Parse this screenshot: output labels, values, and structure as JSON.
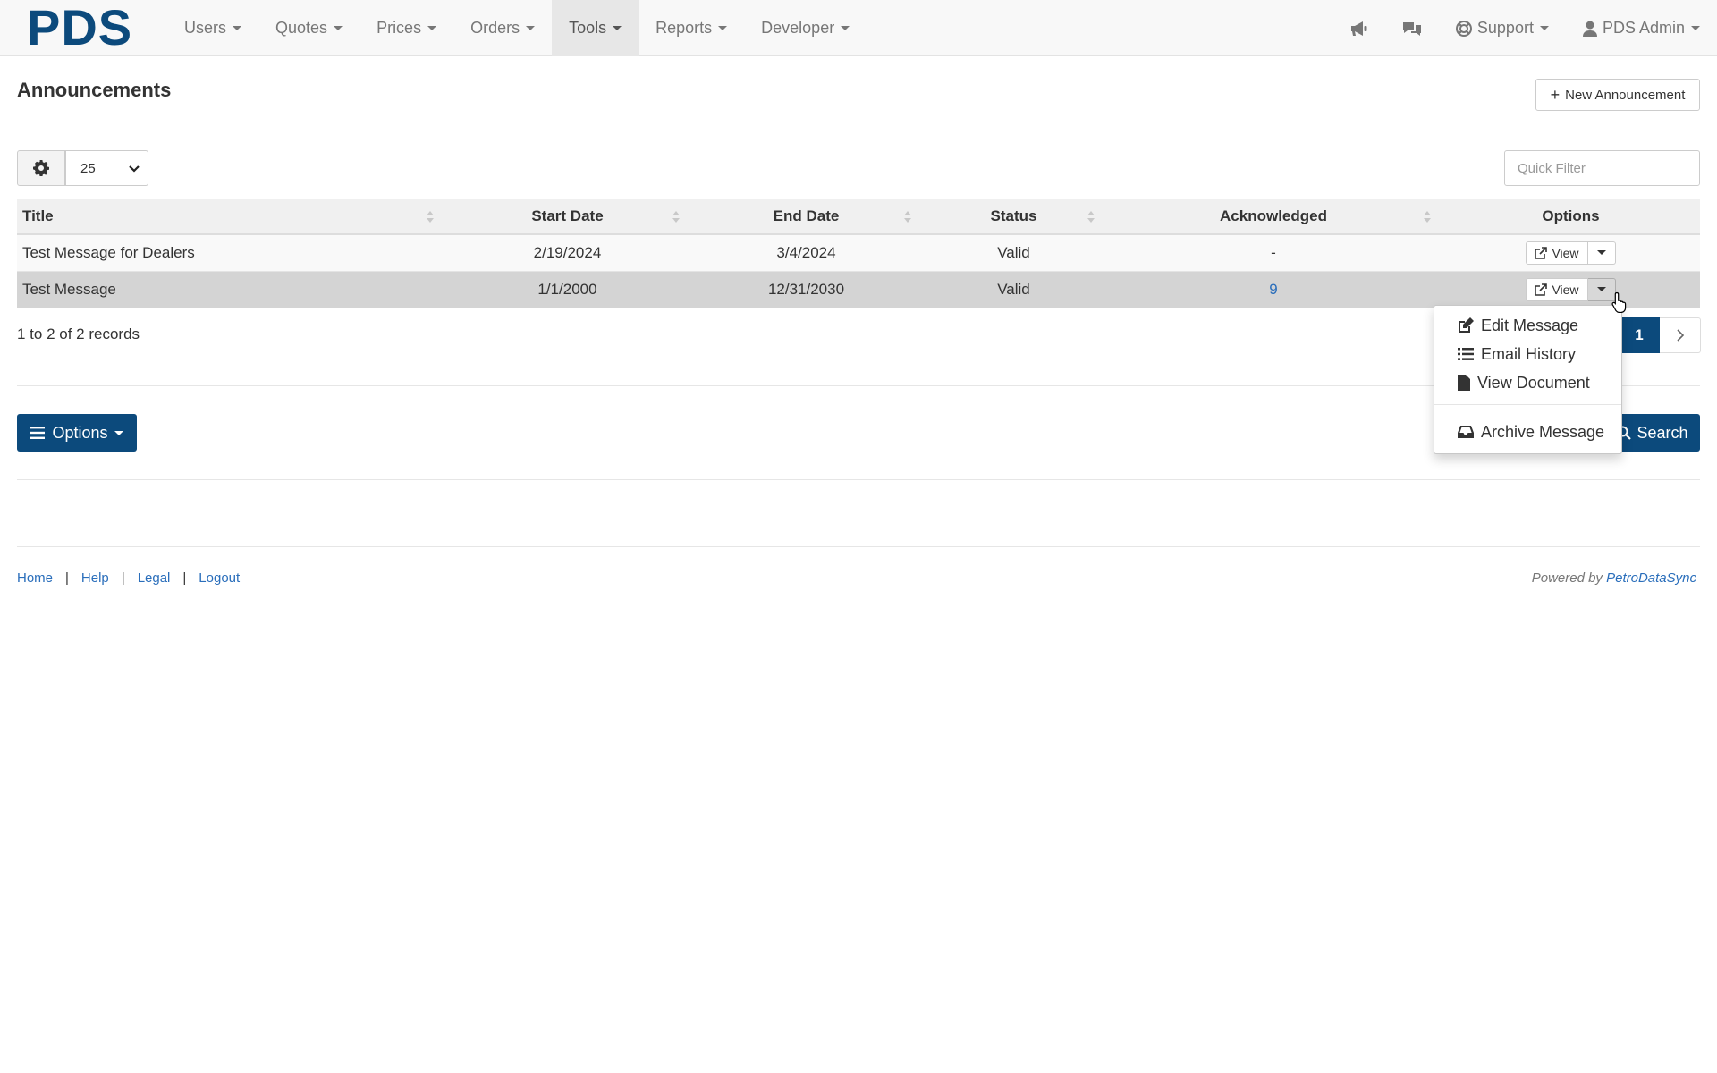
{
  "navbar": {
    "brand": "PDS",
    "menus": [
      {
        "label": "Users"
      },
      {
        "label": "Quotes"
      },
      {
        "label": "Prices"
      },
      {
        "label": "Orders"
      },
      {
        "label": "Tools"
      },
      {
        "label": "Reports"
      },
      {
        "label": "Developer"
      }
    ],
    "support_label": "Support",
    "user_label": "PDS Admin"
  },
  "page": {
    "title": "Announcements",
    "new_button": "New Announcement"
  },
  "toolbar": {
    "page_size": "25",
    "quick_filter_placeholder": "Quick Filter"
  },
  "table": {
    "columns": [
      "Title",
      "Start Date",
      "End Date",
      "Status",
      "Acknowledged",
      "Options"
    ],
    "rows": [
      {
        "title": "Test Message for Dealers",
        "start": "2/19/2024",
        "end": "3/4/2024",
        "status": "Valid",
        "ack": "-",
        "view": "View"
      },
      {
        "title": "Test Message",
        "start": "1/1/2000",
        "end": "12/31/2030",
        "status": "Valid",
        "ack": "9",
        "view": "View"
      }
    ]
  },
  "records_info": "1 to 2 of 2 records",
  "pager": {
    "current": "1"
  },
  "dropdown": {
    "items": [
      "Edit Message",
      "Email History",
      "View Document",
      "Archive Message"
    ]
  },
  "bottom": {
    "options_label": "Options",
    "search_label": "Search"
  },
  "footer": {
    "links": [
      "Home",
      "Help",
      "Legal",
      "Logout"
    ],
    "powered_prefix": "Powered by",
    "powered_brand": "PetroDataSync"
  },
  "colors": {
    "brand": "#0c4a7c",
    "link": "#2a6ebb",
    "selected_row": "#d4d4d4"
  }
}
